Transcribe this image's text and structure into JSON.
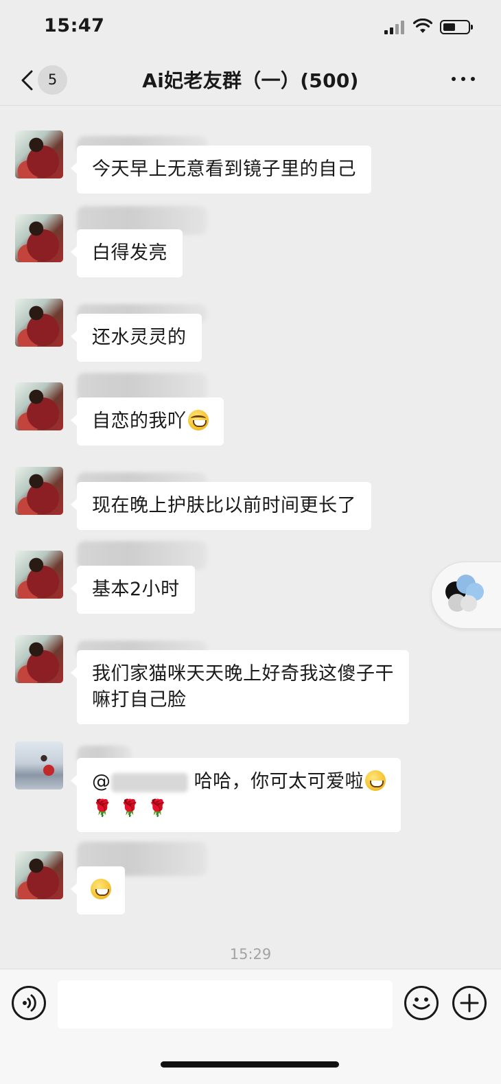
{
  "status_bar": {
    "time": "15:47"
  },
  "nav": {
    "unread_count": "5",
    "title": "Ai妃老友群（一）(500)"
  },
  "messages": [
    {
      "text": "今天早上无意看到镜子里的自己",
      "avatar": "red"
    },
    {
      "text": "白得发亮",
      "avatar": "red"
    },
    {
      "text": "还水灵灵的",
      "avatar": "red"
    },
    {
      "text": "自恋的我吖",
      "emoji": "laughing-crying-emoji",
      "avatar": "red"
    },
    {
      "text": "现在晚上护肤比以前时间更长了",
      "avatar": "red"
    },
    {
      "text": "基本2小时",
      "avatar": "red"
    },
    {
      "text_line1": "我们家猫咪天天晚上好奇我这傻子干",
      "text_line2": "嘛打自己脸",
      "avatar": "red"
    },
    {
      "mention_prefix": "@",
      "text": "哈哈，你可太可爱啦",
      "emoji": "grinning-emoji",
      "roses": [
        "🌹",
        "🌹",
        "🌹"
      ],
      "avatar": "light"
    },
    {
      "emoji": "grinning-emoji",
      "avatar": "red"
    }
  ],
  "timestamp": "15:29",
  "input": {
    "placeholder": ""
  },
  "colors": {
    "background": "#ededed",
    "bubble": "#ffffff",
    "text": "#191919",
    "timestamp": "#a3a3a3"
  }
}
